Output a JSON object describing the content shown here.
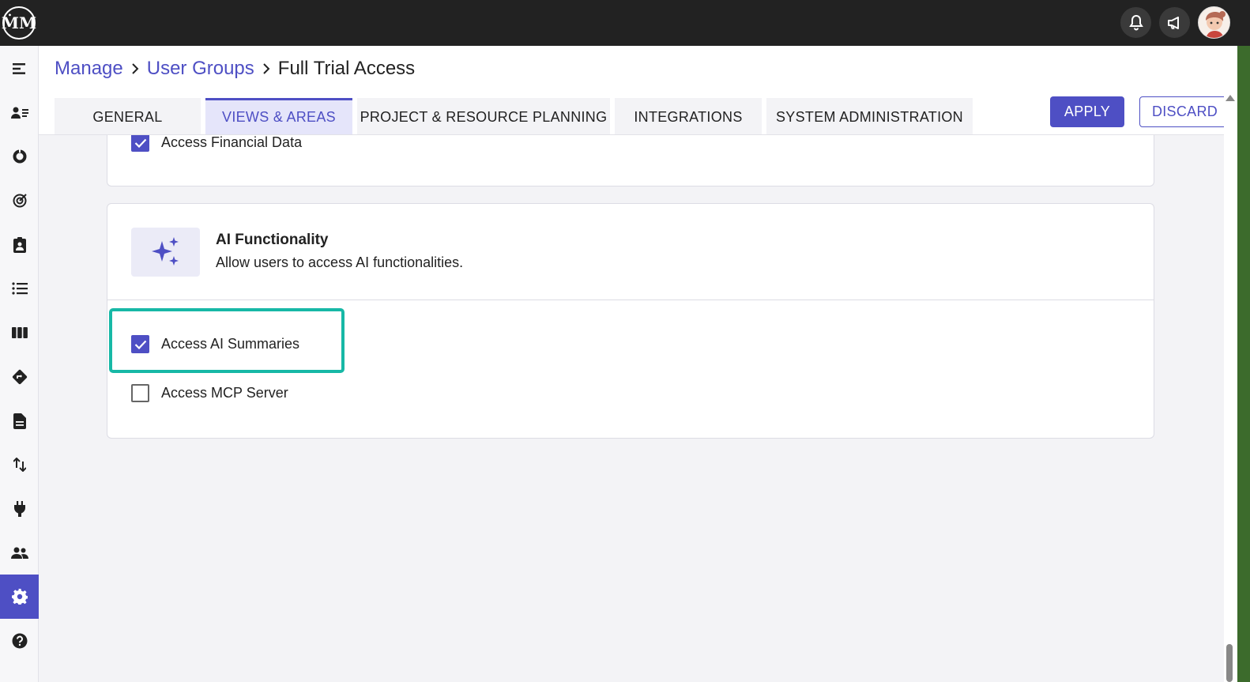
{
  "app": {
    "logo_text": "ṀM"
  },
  "breadcrumb": {
    "items": [
      "Manage",
      "User Groups"
    ],
    "current": "Full Trial Access"
  },
  "tabs": [
    {
      "label": "GENERAL",
      "active": false
    },
    {
      "label": "VIEWS & AREAS",
      "active": true
    },
    {
      "label": "PROJECT & RESOURCE PLANNING",
      "active": false
    },
    {
      "label": "INTEGRATIONS",
      "active": false
    },
    {
      "label": "SYSTEM ADMINISTRATION",
      "active": false
    }
  ],
  "actions": {
    "apply_label": "APPLY",
    "discard_label": "DISCARD"
  },
  "financial_section": {
    "checkbox_label": "Access Financial Data",
    "checked": true
  },
  "ai_section": {
    "title": "AI Functionality",
    "description": "Allow users to access AI functionalities.",
    "icon": "sparkles-icon",
    "options": [
      {
        "label": "Access AI Summaries",
        "checked": true
      },
      {
        "label": "Access MCP Server",
        "checked": false
      }
    ]
  },
  "sidebar": {
    "items": [
      {
        "icon": "menu-collapse-icon"
      },
      {
        "icon": "contacts-icon"
      },
      {
        "icon": "donut-chart-icon"
      },
      {
        "icon": "target-icon"
      },
      {
        "icon": "clipboard-user-icon"
      },
      {
        "icon": "list-icon"
      },
      {
        "icon": "columns-icon"
      },
      {
        "icon": "route-sign-icon"
      },
      {
        "icon": "document-icon"
      },
      {
        "icon": "transfer-arrows-icon"
      },
      {
        "icon": "plug-icon"
      },
      {
        "icon": "users-icon"
      },
      {
        "icon": "settings-icon",
        "active": true
      },
      {
        "icon": "help-icon"
      }
    ]
  },
  "colors": {
    "accent": "#4e4fc4",
    "highlight": "#17b8a6",
    "topbar": "#222222"
  }
}
